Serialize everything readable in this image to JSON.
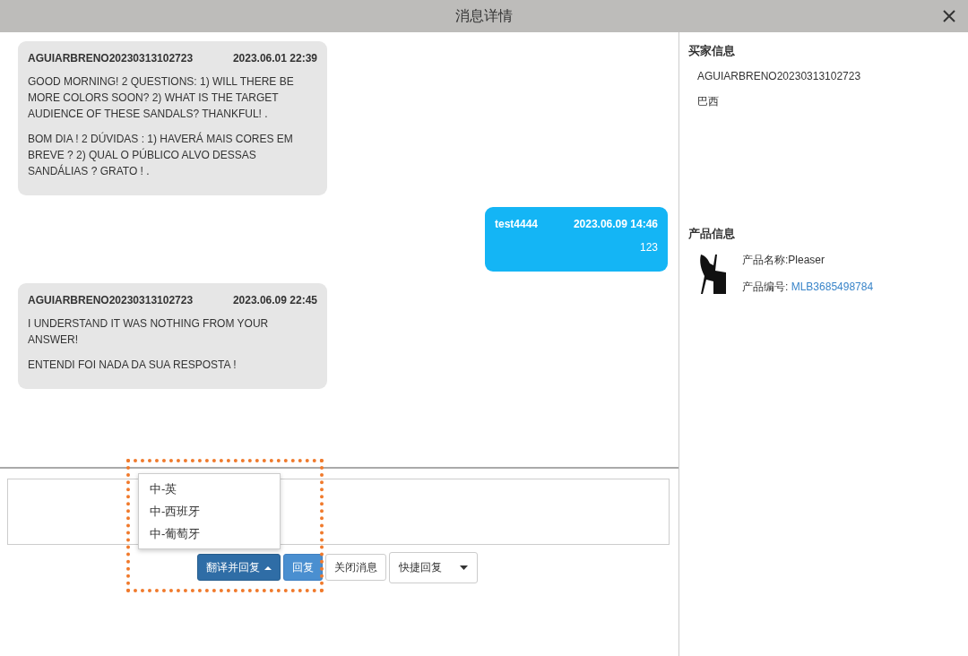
{
  "window": {
    "title": "消息详情"
  },
  "messages": [
    {
      "kind": "incoming",
      "sender": "AGUIARBRENO20230313102723",
      "time": "2023.06.01 22:39",
      "paragraphs": [
        "GOOD MORNING! 2 QUESTIONS: 1) WILL THERE BE MORE COLORS SOON? 2) WHAT IS THE TARGET AUDIENCE OF THESE SANDALS? THANKFUL! .",
        "BOM DIA ! 2 DÚVIDAS : 1) HAVERÁ MAIS CORES EM BREVE ? 2) QUAL O PÚBLICO ALVO DESSAS SANDÁLIAS ? GRATO ! ."
      ]
    },
    {
      "kind": "outgoing",
      "sender": "test4444",
      "time": "2023.06.09 14:46",
      "paragraphs": [
        "123"
      ]
    },
    {
      "kind": "incoming",
      "sender": "AGUIARBRENO20230313102723",
      "time": "2023.06.09 22:45",
      "paragraphs": [
        "I UNDERSTAND IT WAS NOTHING FROM YOUR ANSWER!",
        "ENTENDI FOI NADA DA SUA RESPOSTA !"
      ]
    }
  ],
  "reply": {
    "translate_button": {
      "label": "翻译并回复",
      "expanded": true,
      "menu": [
        "中-英",
        "中-西班牙",
        "中-葡萄牙"
      ]
    },
    "reply_button": "回复",
    "close_button": "关闭消息",
    "quick_reply": {
      "label": "快捷回复"
    }
  },
  "buyer_info": {
    "heading": "买家信息",
    "name": "AGUIARBRENO20230313102723",
    "country": "巴西"
  },
  "product_info": {
    "heading": "产品信息",
    "name_label": "产品名称:",
    "name": "Pleaser",
    "id_label": "产品编号:",
    "id": "MLB3685498784"
  }
}
